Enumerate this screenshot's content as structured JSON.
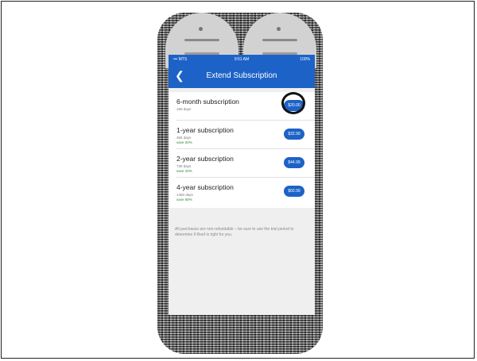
{
  "status_bar": {
    "carrier": "••• MTS",
    "time": "9:51 AM",
    "battery": "100%"
  },
  "nav": {
    "title": "Extend Subscription",
    "back_icon": "chevron-left-icon"
  },
  "subscriptions": [
    {
      "name": "6-month subscription",
      "days": "180 days",
      "save": "",
      "price": "$20.00"
    },
    {
      "name": "1-year subscription",
      "days": "365 days",
      "save": "save 20%",
      "price": "$32.99"
    },
    {
      "name": "2-year subscription",
      "days": "730 days",
      "save": "save 40%",
      "price": "$44.99"
    },
    {
      "name": "4-year subscription",
      "days": "1460 days",
      "save": "save 58%",
      "price": "$60.99"
    }
  ],
  "footer_note": "All purchases are non-refundable – be sure to use the trial period to determine if Reef is right for you.",
  "colors": {
    "accent": "#1d62c7",
    "save_green": "#2f8a3a"
  }
}
